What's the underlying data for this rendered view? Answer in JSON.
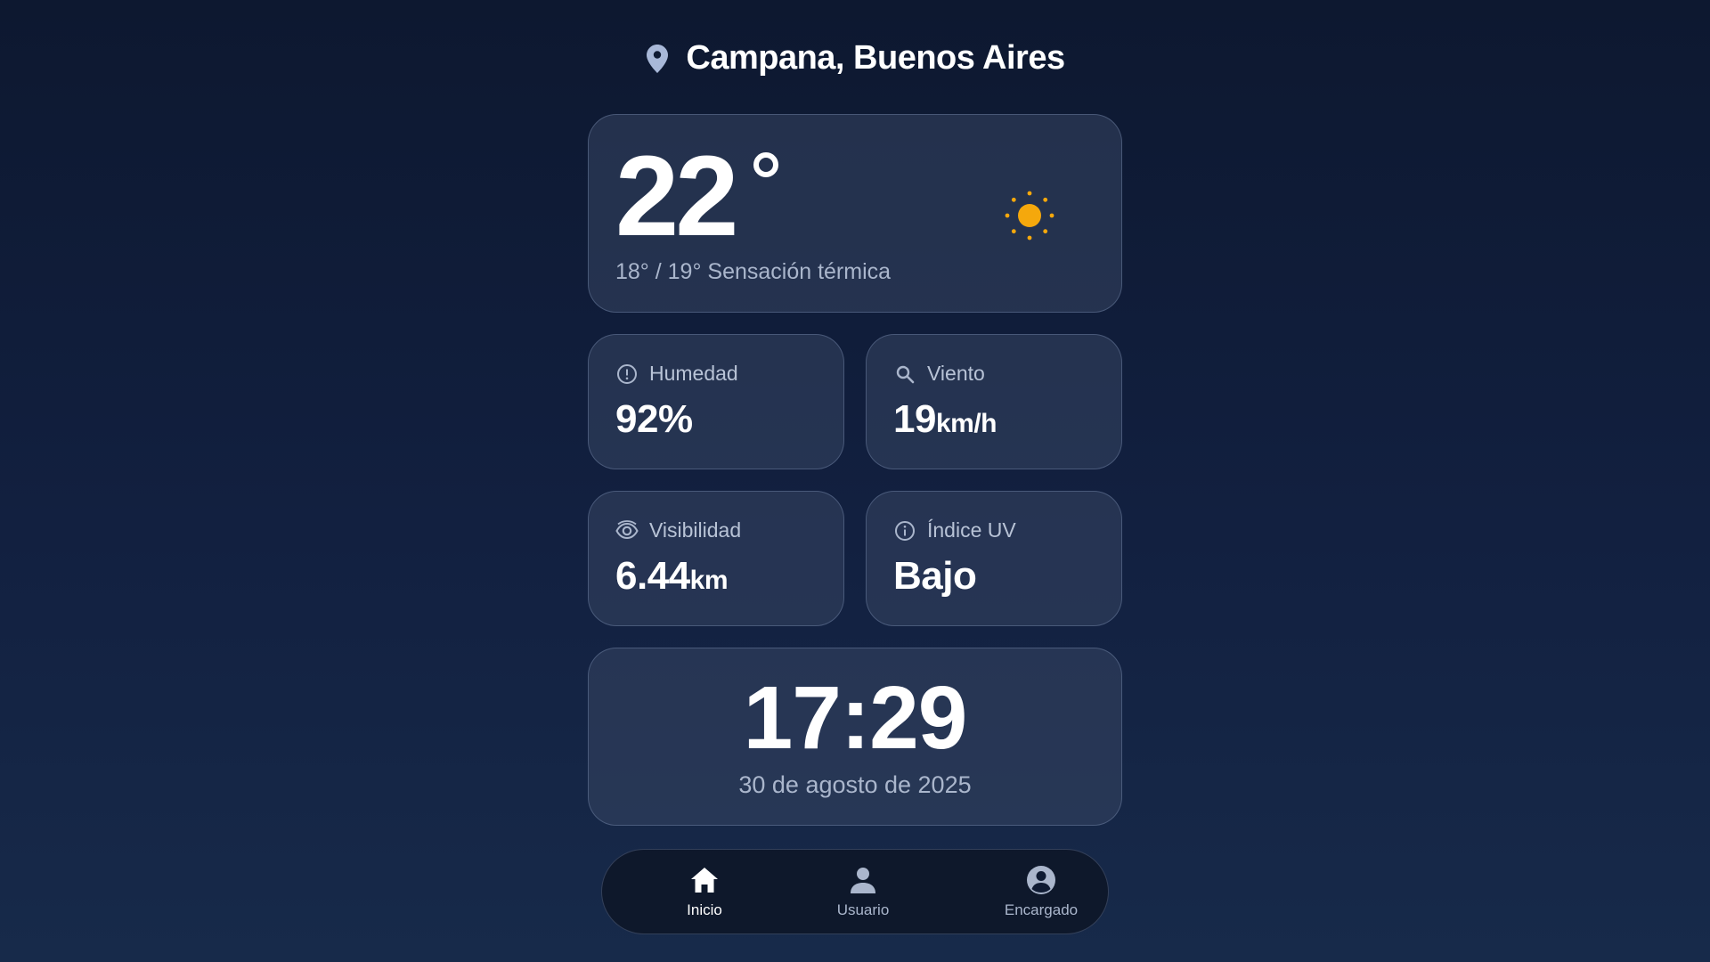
{
  "location": {
    "name": "Campana, Buenos Aires",
    "icon": "location-pin-icon"
  },
  "weather": {
    "temperature": "22",
    "feels_like": "18° / 19° Sensación térmica",
    "condition_icon": "sun-icon",
    "sun_color": "#f5a80c"
  },
  "stats": {
    "humidity": {
      "label": "Humedad",
      "value": "92%",
      "unit": "",
      "icon": "alert-circle-icon"
    },
    "wind": {
      "label": "Viento",
      "value": "19",
      "unit": "km/h",
      "icon": "search-icon"
    },
    "visibility": {
      "label": "Visibilidad",
      "value": "6.44",
      "unit": "km",
      "icon": "eye-icon"
    },
    "uv": {
      "label": "Índice UV",
      "value": "Bajo",
      "unit": "",
      "icon": "info-icon"
    }
  },
  "clock": {
    "time": "17:29",
    "date": "30 de agosto de 2025"
  },
  "nav": {
    "items": [
      {
        "label": "Inicio",
        "icon": "home-icon",
        "active": true
      },
      {
        "label": "Usuario",
        "icon": "user-icon",
        "active": false
      },
      {
        "label": "Encargado",
        "icon": "account-circle-icon",
        "active": false
      }
    ]
  }
}
